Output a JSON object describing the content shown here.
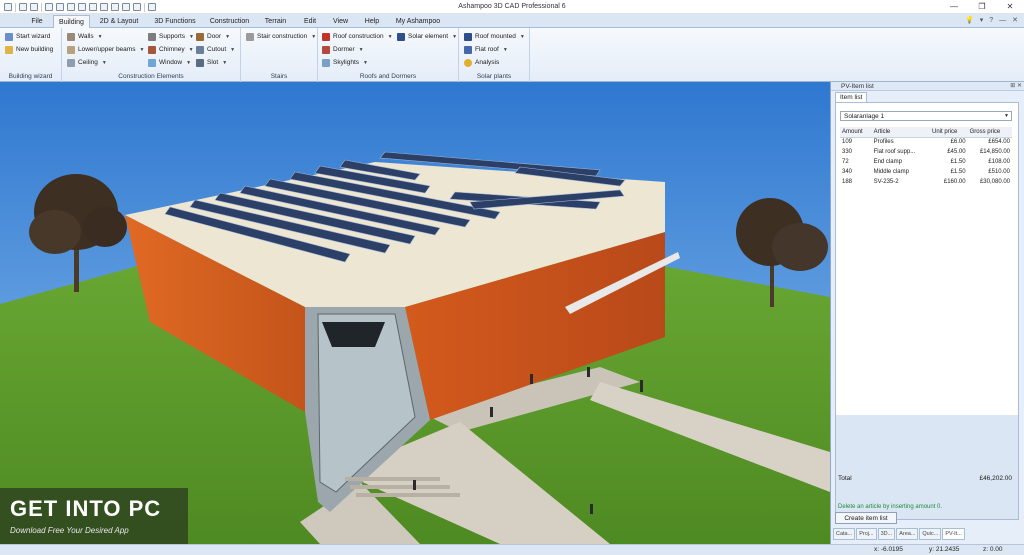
{
  "window": {
    "title": "Ashampoo 3D CAD Professional 6",
    "minimize": "—",
    "maximize": "❐",
    "close": "✕"
  },
  "menu": {
    "tabs": [
      "File",
      "Building",
      "2D & Layout",
      "3D Functions",
      "Construction",
      "Terrain",
      "Edit",
      "View",
      "Help",
      "My Ashampoo"
    ],
    "active": "Building",
    "right_icons": [
      "help-icon",
      "minimize-ribbon-icon",
      "close-doc-icon"
    ]
  },
  "ribbon": {
    "groups": {
      "building_wizard": {
        "label": "Building wizard",
        "items": [
          "Start wizard",
          "New building"
        ]
      },
      "construction_elements": {
        "label": "Construction Elements",
        "items": [
          "Walls",
          "Lower/upper beams",
          "Ceiling",
          "Supports",
          "Chimney",
          "Window",
          "Door",
          "Cutout",
          "Slot"
        ]
      },
      "stairs": {
        "label": "Stairs",
        "items": [
          "Stair construction"
        ]
      },
      "roofs_dormers": {
        "label": "Roofs and Dormers",
        "items": [
          "Roof construction",
          "Dormer",
          "Skylights",
          "Solar element"
        ]
      },
      "solar_plants": {
        "label": "Solar plants",
        "items": [
          "Roof mounted",
          "Flat roof",
          "Analysis"
        ]
      }
    }
  },
  "panel": {
    "title": "PV-Item list",
    "tab": "Item list",
    "select_value": "Solaranlage 1",
    "columns": [
      "Amount",
      "Article",
      "Unit price",
      "Gross price"
    ],
    "rows": [
      {
        "amount": "109",
        "article": "Profiles",
        "unit": "£6.00",
        "gross": "£654.00"
      },
      {
        "amount": "330",
        "article": "Flat roof supp...",
        "unit": "£45.00",
        "gross": "£14,850.00"
      },
      {
        "amount": "72",
        "article": "End clamp",
        "unit": "£1.50",
        "gross": "£108.00"
      },
      {
        "amount": "340",
        "article": "Middle clamp",
        "unit": "£1.50",
        "gross": "£510.00"
      },
      {
        "amount": "188",
        "article": "SV-235-2",
        "unit": "£160.00",
        "gross": "£30,080.00"
      }
    ],
    "total_label": "Total",
    "total_value": "£46,202.00",
    "hint": "Delete an article by inserting amount 0.",
    "button": "Create item list",
    "bottom_tabs": [
      "Cata...",
      "Proj...",
      "3D...",
      "Area...",
      "Quic...",
      "PV-It..."
    ],
    "active_bottom_tab": "PV-It..."
  },
  "status": {
    "x": "x: -6.0195",
    "y": "y: 21.2435",
    "z": "z: 0.00"
  },
  "watermark": {
    "title": "GET INTO PC",
    "subtitle": "Download Free Your Desired App"
  },
  "colors": {
    "ribbon_bg": "#e4edf8",
    "sky": "#3e86d8",
    "facade": "#d9601f",
    "grass": "#5f9e2a",
    "hint_green": "#1f8a3a"
  }
}
